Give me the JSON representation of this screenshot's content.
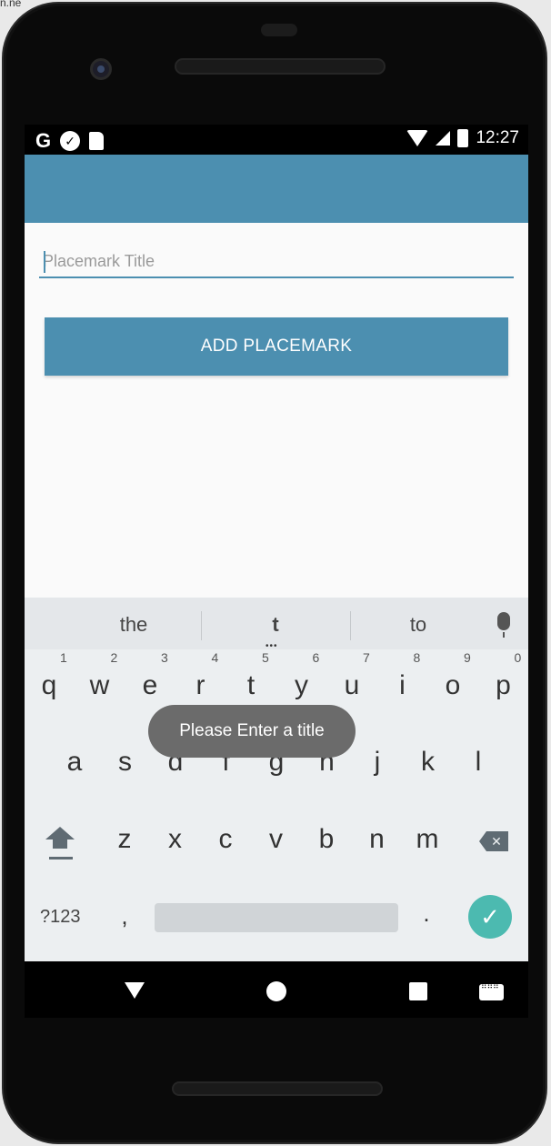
{
  "background": {
    "text": "n.ne"
  },
  "status_bar": {
    "left_icons": [
      "google-g-icon",
      "check-shield-icon",
      "sd-card-icon"
    ],
    "google_label": "G",
    "time": "12:27"
  },
  "app": {
    "title_input": {
      "placeholder": "Placemark Title",
      "value": ""
    },
    "add_button_label": "ADD PLACEMARK",
    "colors": {
      "primary": "#4c8fb0",
      "background": "#fafafa"
    }
  },
  "keyboard": {
    "suggestions": [
      "the",
      "t",
      "to"
    ],
    "row1": [
      "q",
      "w",
      "e",
      "r",
      "t",
      "y",
      "u",
      "i",
      "o",
      "p"
    ],
    "row1_hints": [
      "1",
      "2",
      "3",
      "4",
      "5",
      "6",
      "7",
      "8",
      "9",
      "0"
    ],
    "row2": [
      "a",
      "s",
      "d",
      "f",
      "g",
      "h",
      "j",
      "k",
      "l"
    ],
    "row3": [
      "z",
      "x",
      "c",
      "v",
      "b",
      "n",
      "m"
    ],
    "symbols_label": "?123",
    "comma": ",",
    "period": ".",
    "enter_icon": "check-icon"
  },
  "toast": {
    "message": "Please Enter a title"
  },
  "nav_bar": {
    "icons": [
      "back-icon",
      "home-icon",
      "recents-icon",
      "keyboard-switch-icon"
    ]
  }
}
